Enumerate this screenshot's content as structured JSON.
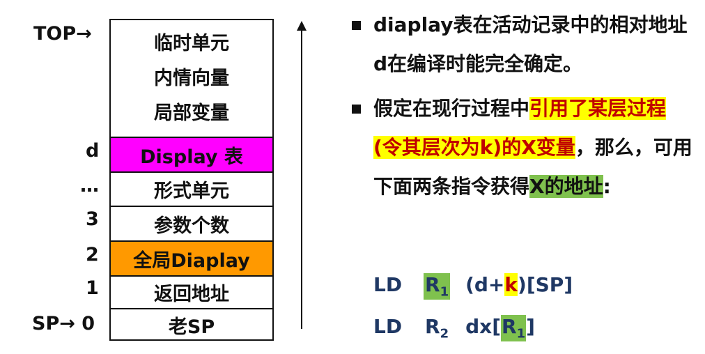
{
  "labels": {
    "top": "TOP→",
    "d": "d",
    "dots": "…",
    "three": "3",
    "two": "2",
    "one": "1",
    "sp": "SP→ 0"
  },
  "stack": {
    "top_lines": [
      "临时单元",
      "内情向量",
      "局部变量"
    ],
    "display": "Display 表",
    "formal": "形式单元",
    "param_count": "参数个数",
    "global_display": "全局Diaplay",
    "return_addr": "返回地址",
    "old_sp": "老SP"
  },
  "colors": {
    "display_cell": "#ff00ff",
    "global_display_cell": "#ff9900",
    "highlight_yellow": "#ffff00",
    "highlight_green": "#7fc14e",
    "highlight_text_red": "#c00000",
    "instruction_blue": "#1f3864"
  },
  "text": {
    "p1": "diaplay表在活动记录中的相对地址d在编译时能完全确定。",
    "p2_a": "假定在现行过程中",
    "p2_b": "引用了某层过程(令其层次为k)的X变量",
    "p2_c": "，那么，可用下面两条指令获得",
    "p2_d": "X的地址",
    "p2_e": ":"
  },
  "instructions": {
    "i1_op": "LD",
    "i1_reg": "R",
    "i1_sub": "1",
    "i1_arg_a": "(d+",
    "i1_arg_k": "k",
    "i1_arg_b": ")[SP]",
    "i2_op": "LD",
    "i2_reg": "R",
    "i2_sub": "2",
    "i2_arg_a": "dx[",
    "i2_arg_reg": "R",
    "i2_arg_sub": "1",
    "i2_arg_b": "]"
  }
}
